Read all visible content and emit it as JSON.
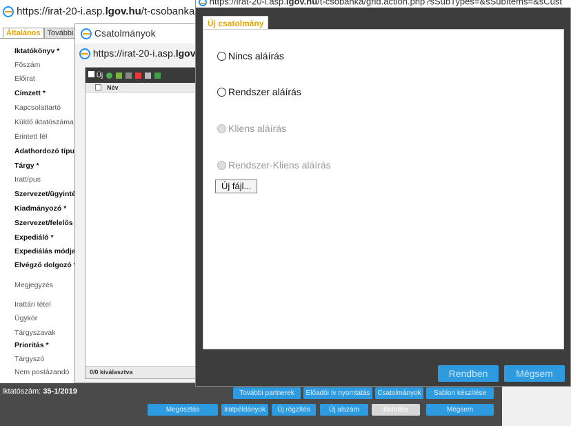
{
  "main_window": {
    "url_prefix": "https://irat-20-i.asp.",
    "url_domain": "lgov.hu",
    "url_suffix": "/t-csobanka/edit.pl",
    "tabs": [
      {
        "label": "Általános"
      },
      {
        "label": "További"
      }
    ],
    "fields": [
      {
        "label": "Iktatókönyv *"
      },
      {
        "label": "Főszám"
      },
      {
        "label": "Előirat"
      },
      {
        "label": "Címzett *"
      },
      {
        "label": "Kapcsolattartó"
      },
      {
        "label": "Küldő iktatószáma"
      },
      {
        "label": "Érintett fél"
      },
      {
        "label": "Adathordozó típus"
      },
      {
        "label": "Tárgy *"
      },
      {
        "label": "Irattípus"
      },
      {
        "label": "Szervezet/ügyinté"
      },
      {
        "label": "Kiadmányozó *"
      },
      {
        "label": "Szervezet/felelős v"
      },
      {
        "label": "Expediáló *"
      },
      {
        "label": "Expediálás módja"
      },
      {
        "label": "Elvégző dolgozó *"
      },
      {
        "label": "Megjegyzés"
      },
      {
        "label": "Irattári tétel"
      },
      {
        "label": "Ügykör"
      },
      {
        "label": "Tárgyszavak"
      },
      {
        "label": "Prioritás *"
      },
      {
        "label": "Tárgyszó"
      },
      {
        "label": "Nem postázandó"
      }
    ],
    "iktatoszam_label": "Iktatószám:",
    "iktatoszam_value": "35-1/2019",
    "buttons_row1": [
      {
        "label": "További partnerek"
      },
      {
        "label": "Előadói ív nyomtatás"
      },
      {
        "label": "Csatolmányok"
      },
      {
        "label": "Sablon készítése"
      }
    ],
    "buttons_row2": [
      {
        "label": "Megosztás"
      },
      {
        "label": "Iratpéldányok"
      },
      {
        "label": "Új rögzítés"
      },
      {
        "label": "Új alszám"
      },
      {
        "label": "Betöltés"
      },
      {
        "label": "Mégsem"
      }
    ]
  },
  "attachments_window": {
    "title": "Csatolmányok",
    "url_prefix": "https://irat-20-i.asp.",
    "url_domain": "lgov.hu",
    "new_label": "Új",
    "column_name": "Név",
    "footer": "0/0 kiválasztva"
  },
  "dialog": {
    "url_prefix": "https://irat-20-i.asp.",
    "url_domain": "lgov.hu",
    "url_suffix": "/t-csobanka/grid.action.php?sSubTypes=&sSubItems=&sCust",
    "tab_label": "Új csatolmány",
    "options": [
      {
        "label": "Nincs aláírás",
        "enabled": true
      },
      {
        "label": "Rendszer aláírás",
        "enabled": true
      },
      {
        "label": "Kliens aláírás",
        "enabled": false
      },
      {
        "label": "Rendszer-Kliens aláírás",
        "enabled": false
      }
    ],
    "new_file_label": "Új fájl...",
    "ok_label": "Rendben",
    "cancel_label": "Mégsem"
  }
}
